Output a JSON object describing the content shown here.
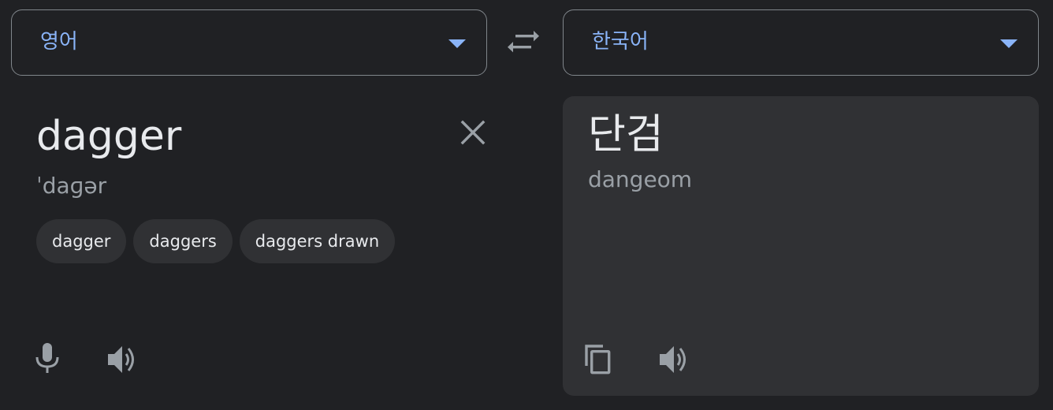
{
  "source": {
    "language": "영어",
    "text": "dagger",
    "phonetic": "ˈdaɡər",
    "suggestions": [
      "dagger",
      "daggers",
      "daggers drawn"
    ]
  },
  "target": {
    "language": "한국어",
    "text": "단검",
    "romanization": "dangeom"
  },
  "icons": {
    "swap": "swap-arrows-icon",
    "clear": "close-icon",
    "mic": "microphone-icon",
    "listen": "speaker-icon",
    "copy": "copy-icon",
    "dropdown": "caret-down-icon"
  },
  "colors": {
    "background": "#202124",
    "card": "#303134",
    "accent": "#8ab4f8",
    "text": "#e8eaed",
    "muted": "#9aa0a6",
    "border": "#80868b"
  }
}
